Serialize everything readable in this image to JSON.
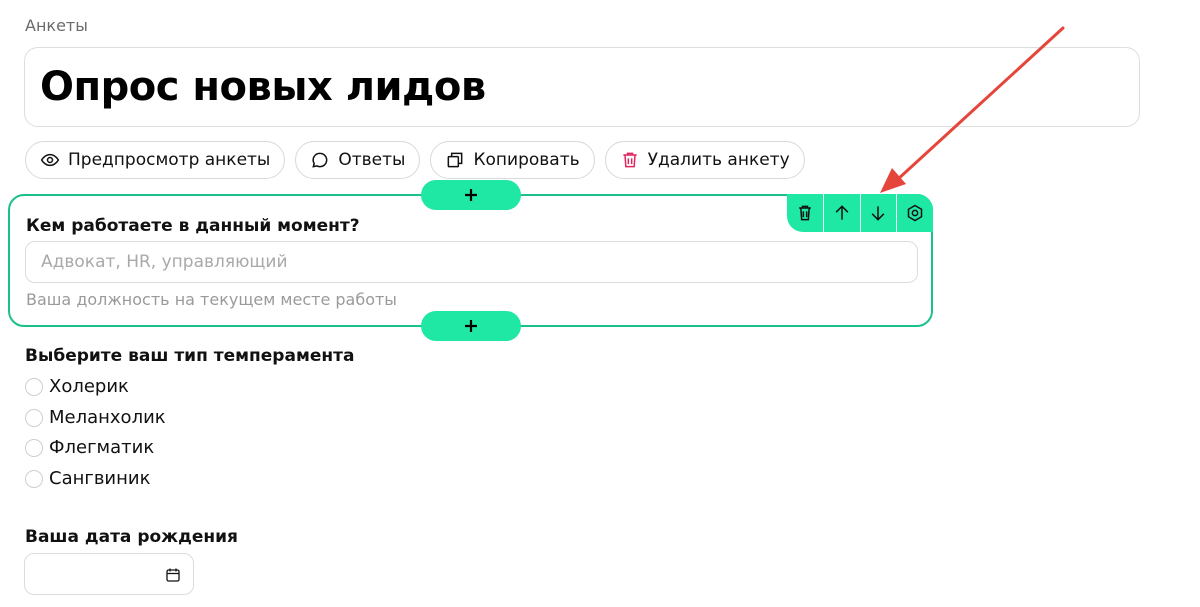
{
  "breadcrumb": "Анкеты",
  "survey_title": "Опрос новых лидов",
  "toolbar": {
    "preview_label": "Предпросмотр анкеты",
    "answers_label": "Ответы",
    "copy_label": "Копировать",
    "delete_label": "Удалить анкету"
  },
  "colors": {
    "accent": "#1fe8a4",
    "accent_border": "#1cc08c",
    "delete_icon": "#e0245e",
    "annotation_arrow": "#e5453a"
  },
  "questions": [
    {
      "label": "Кем работаете в данный момент?",
      "placeholder": "Адвокат, HR, управляющий",
      "value": "",
      "hint": "Ваша должность на текущем месте работы",
      "selected": true,
      "tools": [
        "trash-icon",
        "arrow-up-icon",
        "arrow-down-icon",
        "settings-icon"
      ]
    },
    {
      "label": "Выберите ваш тип темперамента",
      "options": [
        "Холерик",
        "Меланхолик",
        "Флегматик",
        "Сангвиник"
      ]
    },
    {
      "label": "Ваша дата рождения",
      "value": "",
      "icon": "calendar-icon"
    }
  ]
}
